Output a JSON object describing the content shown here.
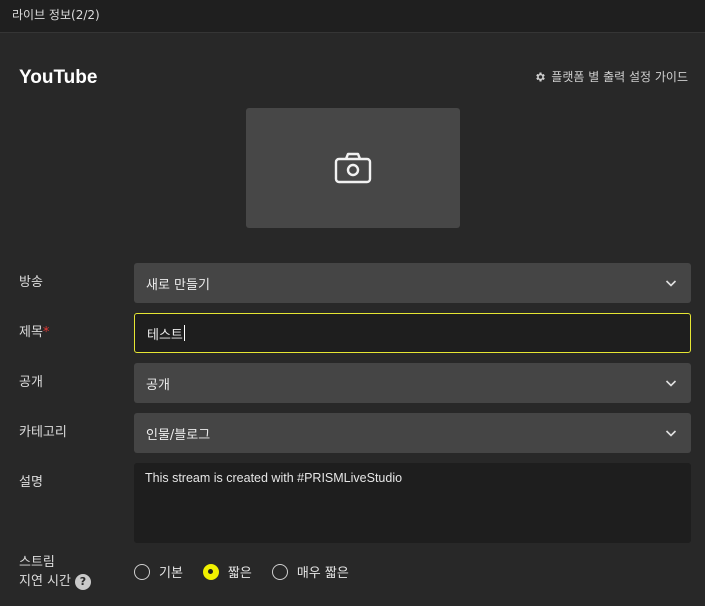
{
  "window": {
    "title": "라이브 정보(2/2)"
  },
  "platform": {
    "name": "YouTube"
  },
  "guide_link": {
    "label": "플랫폼 별 출력 설정 가이드",
    "icon": "gear-icon"
  },
  "thumbnail": {
    "icon": "camera-icon"
  },
  "broadcast": {
    "label": "방송",
    "value": "새로 만들기"
  },
  "title_field": {
    "label": "제목",
    "required_mark": "*",
    "value": "테스트"
  },
  "privacy": {
    "label": "공개",
    "value": "공개"
  },
  "category": {
    "label": "카테고리",
    "value": "인물/블로그"
  },
  "description": {
    "label": "설명",
    "value": "This stream is created with #PRISMLiveStudio"
  },
  "latency": {
    "label_line1": "스트림",
    "label_line2": "지연 시간",
    "help": "?",
    "options": [
      {
        "label": "기본",
        "selected": false
      },
      {
        "label": "짧은",
        "selected": true
      },
      {
        "label": "매우 짧은",
        "selected": false
      }
    ]
  },
  "colors": {
    "accent": "#f0f000",
    "background": "#282828",
    "field": "#454545"
  }
}
